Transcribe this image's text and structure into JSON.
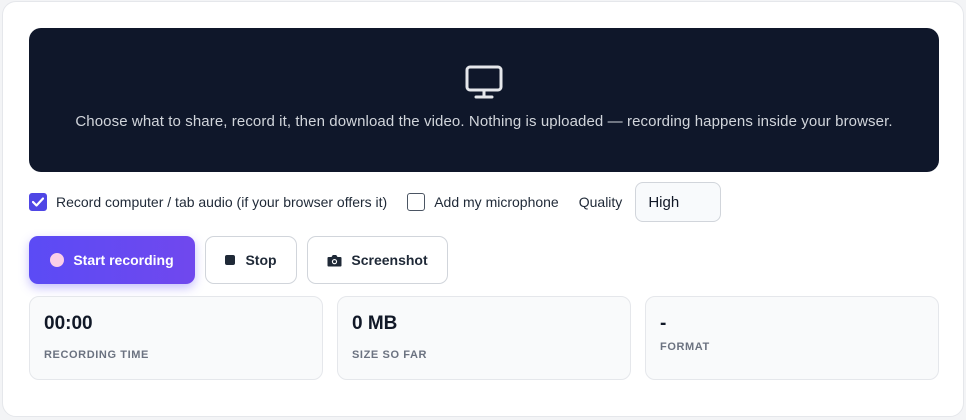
{
  "preview": {
    "icon": "monitor-icon",
    "hint": "Choose what to share, record it, then download the video. Nothing is uploaded — recording happens inside your browser."
  },
  "options": {
    "system_audio": {
      "label": "Record computer / tab audio (if your browser offers it)",
      "checked": true
    },
    "microphone": {
      "label": "Add my microphone",
      "checked": false
    },
    "quality_label": "Quality",
    "quality_value": "High"
  },
  "actions": {
    "start_label": "Start recording",
    "stop_label": "Stop",
    "screenshot_label": "Screenshot"
  },
  "stats": [
    {
      "value": "00:00",
      "label": "RECORDING TIME"
    },
    {
      "value": "0 MB",
      "label": "SIZE SO FAR"
    },
    {
      "value": "-",
      "label": "FORMAT"
    }
  ],
  "colors": {
    "accent": "#5b4bf5",
    "preview_bg": "#0f172a",
    "checkbox": "#4f46e5"
  }
}
